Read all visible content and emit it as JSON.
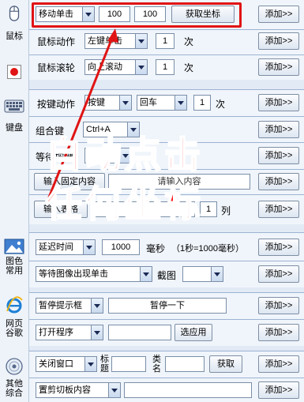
{
  "sidebar": {
    "mouse_label": "鼠标",
    "keyboard_label": "键盘",
    "image_label": "图色\n常用",
    "web_label": "网页\n谷歌",
    "other_label": "其他\n综合"
  },
  "mouse": {
    "move": {
      "mode": "移动单击",
      "x": "100",
      "y": "100",
      "get_coords": "获取坐标",
      "add": "添加>>"
    },
    "action": {
      "label": "鼠标动作",
      "button": "左键单击",
      "count": "1",
      "unit": "次",
      "add": "添加>>"
    },
    "wheel": {
      "label": "鼠标滚轮",
      "direction": "向上滚动",
      "count": "1",
      "unit": "次",
      "add": "添加>>"
    }
  },
  "keyboard": {
    "key_action": {
      "label": "按键动作",
      "mode": "按键",
      "key": "回车",
      "count": "1",
      "unit": "次",
      "add": "添加>>"
    },
    "combo": {
      "label": "组合键",
      "value": "Ctrl+A",
      "add": "添加>>"
    },
    "wait_key": {
      "label": "等待按键",
      "add": "添加>>"
    },
    "input_fixed": {
      "label": "输入固定内容",
      "placeholder": "请输入内容",
      "add": "添加>>"
    },
    "input_table": {
      "label": "输入表格",
      "col_value": "1",
      "col_unit": "列",
      "add": "添加>>"
    }
  },
  "image": {
    "delay": {
      "label": "延迟时间",
      "value": "1000",
      "unit": "毫秒",
      "hint": "（1秒=1000毫秒）",
      "add": "添加>>"
    },
    "wait_image": {
      "mode": "等待图像出现单击",
      "capture_label": "截图",
      "add": "添加>>"
    }
  },
  "web": {
    "pause": {
      "label": "暂停提示框",
      "message": "暂停一下",
      "add": "添加>>"
    },
    "open": {
      "label": "打开程序",
      "select": "选应用",
      "add": "添加>>"
    }
  },
  "other": {
    "close": {
      "label": "关闭窗口",
      "title_label": "标\n题",
      "class_label": "类\n名",
      "get": "获取",
      "add": "添加>>"
    },
    "clipboard": {
      "label": "置剪切板内容",
      "add": "添加>>"
    }
  },
  "overlay": {
    "line1": "自动点击",
    "line2": "任何坐标"
  },
  "colors": {
    "highlight": "#e01414",
    "overlay_text": "#ff1a1a",
    "panel": "#f0f5fb",
    "border": "#9db3d2"
  }
}
